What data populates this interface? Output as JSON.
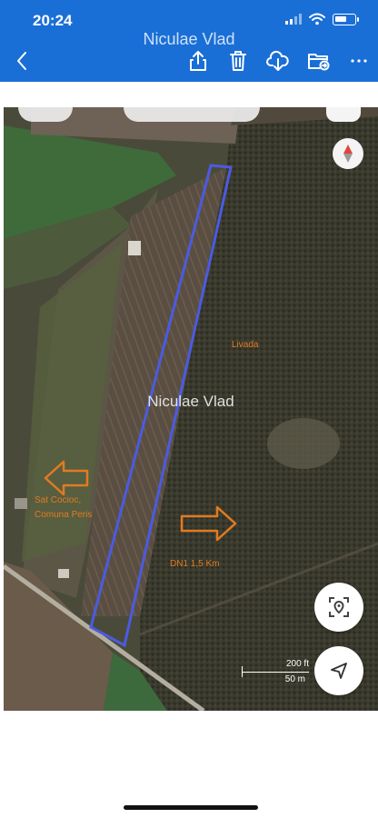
{
  "status_bar": {
    "time": "20:24"
  },
  "header": {
    "title": "Niculae Vlad",
    "back_icon": "chevron-left-icon",
    "actions": [
      "share-icon",
      "trash-icon",
      "cloud-download-icon",
      "folder-move-icon",
      "more-icon"
    ]
  },
  "map": {
    "watermark": "Niculae Vlad",
    "labels": {
      "livada": "Livada",
      "village_line1": "Sat Cocioc,",
      "village_line2": "Comuna Peris",
      "road": "DN1 1,5 Km"
    },
    "scale": {
      "feet": "200 ft",
      "meters": "50 m"
    },
    "colors": {
      "boundary": "#4b5be0",
      "annotation": "#e07b22",
      "header": "#1a6fd6"
    }
  }
}
